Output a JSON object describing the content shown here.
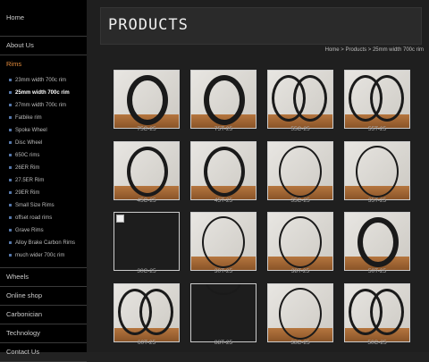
{
  "sidebar": {
    "top_items": [
      "Home",
      "About Us"
    ],
    "active_section": "Rims",
    "sub_items": [
      {
        "label": "23mm width 700c rim",
        "active": false
      },
      {
        "label": "25mm width 700c rim",
        "active": true
      },
      {
        "label": "27mm width 700c rim",
        "active": false
      },
      {
        "label": "Fatbike rim",
        "active": false
      },
      {
        "label": "Spoke Wheel",
        "active": false
      },
      {
        "label": "Disc Wheel",
        "active": false
      },
      {
        "label": "650C rims",
        "active": false
      },
      {
        "label": "26ER Rim",
        "active": false
      },
      {
        "label": "27.5ER Rim",
        "active": false
      },
      {
        "label": "29ER Rim",
        "active": false
      },
      {
        "label": "Small Size Rims",
        "active": false
      },
      {
        "label": "offset road rims",
        "active": false
      },
      {
        "label": "Grave Rims",
        "active": false
      },
      {
        "label": "Alloy Brake Carbon Rims",
        "active": false
      },
      {
        "label": "much wider 700c rim",
        "active": false
      }
    ],
    "bottom_items": [
      "Wheels",
      "Online shop",
      "Carbonician",
      "Technology",
      "Contact Us"
    ]
  },
  "page": {
    "title": "PRODUCTS",
    "breadcrumb": "Home > Products > 25mm width 700c rim"
  },
  "products": [
    {
      "label": "75C-25",
      "style": "single-deep"
    },
    {
      "label": "75T-25",
      "style": "single-deep"
    },
    {
      "label": "55C-25",
      "style": "pair"
    },
    {
      "label": "55T-25",
      "style": "pair"
    },
    {
      "label": "45C-25",
      "style": "single-mid"
    },
    {
      "label": "45T-25",
      "style": "single-mid"
    },
    {
      "label": "35C-25",
      "style": "single-thin"
    },
    {
      "label": "35T-25",
      "style": "single-thin"
    },
    {
      "label": "30C-25",
      "style": "broken"
    },
    {
      "label": "30T-25",
      "style": "single-thin"
    },
    {
      "label": "38T-25",
      "style": "single-thin"
    },
    {
      "label": "50T-25",
      "style": "single-deep"
    },
    {
      "label": "60T-25",
      "style": "pair"
    },
    {
      "label": "88T-25",
      "style": "dark"
    },
    {
      "label": "38C-25",
      "style": "single-thin"
    },
    {
      "label": "50C-25",
      "style": "pair"
    }
  ]
}
